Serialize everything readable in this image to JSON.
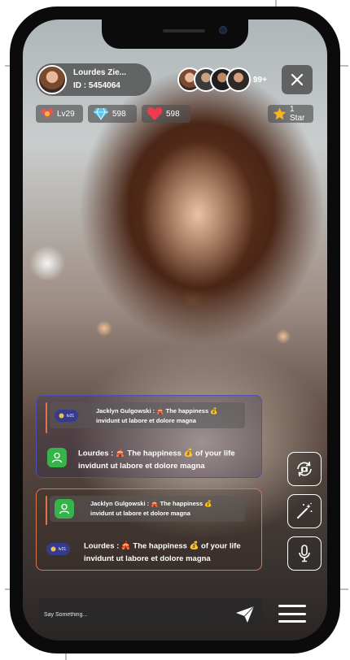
{
  "header": {
    "username": "Lourdes Zie...",
    "user_id": "ID : 5454064",
    "viewer_count": "99+"
  },
  "stats": {
    "level": "Lv29",
    "diamonds": "598",
    "hearts": "598",
    "stars": "1 Star"
  },
  "chat": [
    {
      "nested_name": "Jacklyn Gulgowski :",
      "nested_line1": "The happiness",
      "nested_line2": "invidunt ut labore et dolore magna",
      "nested_badge": "lv21",
      "main_name": "Lourdes :",
      "main_line1": "The happiness",
      "main_line1_tail": "of your life",
      "main_line2": "invidunt ut labore et dolore magna"
    },
    {
      "nested_name": "Jacklyn Gulgowski :",
      "nested_line1": "The happiness",
      "nested_line2": "invidunt ut labore et dolore magna",
      "main_badge": "lv21",
      "main_name": "Lourdes :",
      "main_line1": "The happiness",
      "main_line1_tail": "of your life",
      "main_line2": "invidunt ut labore et dolore magna"
    }
  ],
  "composer": {
    "placeholder": "Say Something..."
  },
  "colors": {
    "chat_border_1": "#4c4fb6",
    "chat_border_2": "#e0744a",
    "accent_green": "#35b44a",
    "badge_blue": "#353b8e"
  },
  "icons": [
    "close-icon",
    "heart-medal-icon",
    "diamond-icon",
    "heart-icon",
    "star-icon",
    "user-icon",
    "flip-camera-icon",
    "magic-wand-icon",
    "microphone-icon",
    "send-icon",
    "menu-icon"
  ]
}
